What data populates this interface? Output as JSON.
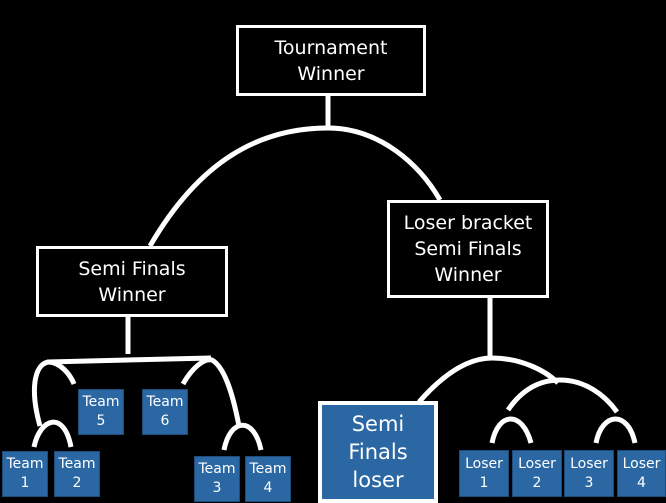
{
  "nodes": {
    "tournament_winner": "Tournament\nWinner",
    "semi_finals_winner": "Semi Finals\nWinner",
    "loser_bracket_winner": "Loser bracket\nSemi Finals\nWinner",
    "semi_finals_loser": "Semi\nFinals\nloser"
  },
  "teams": [
    "Team\n1",
    "Team\n2",
    "Team\n3",
    "Team\n4",
    "Team\n5",
    "Team\n6"
  ],
  "losers": [
    "Loser\n1",
    "Loser\n2",
    "Loser\n3",
    "Loser\n4"
  ],
  "colors": {
    "background": "#000000",
    "team_fill": "#2b68a3",
    "line": "#ffffff"
  }
}
